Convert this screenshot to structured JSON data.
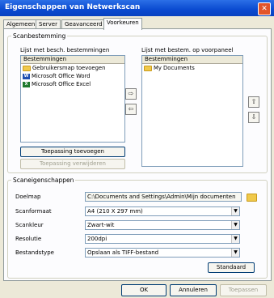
{
  "window": {
    "title": "Eigenschappen van Netwerkscan",
    "close_symbol": "✕"
  },
  "tabs": [
    "Algemeen",
    "Server",
    "Geavanceerd",
    "Voorkeuren"
  ],
  "scan_destination": {
    "legend": "Scanbestemming",
    "left_list": {
      "label": "Lijst met besch. bestemmingen",
      "header": "Bestemmingen",
      "items": [
        {
          "label": "Gebruikersmap toevoegen",
          "icon": "folder-icon"
        },
        {
          "label": "Microsoft Office Word",
          "icon": "word-icon",
          "glyph": "W"
        },
        {
          "label": "Microsoft Office Excel",
          "icon": "excel-icon",
          "glyph": "X"
        }
      ]
    },
    "right_list": {
      "label": "Lijst met bestem. op voorpaneel",
      "header": "Bestemmingen",
      "items": [
        {
          "label": "My Documents",
          "icon": "folder-icon"
        }
      ]
    },
    "add_app_button": "Toepassing toevoegen",
    "remove_app_button": "Toepassing verwijderen",
    "move_right_glyph": "⇨",
    "move_left_glyph": "⇦",
    "move_up_glyph": "⇧",
    "move_down_glyph": "⇩"
  },
  "scan_properties": {
    "legend": "Scaneigenschappen",
    "destination_folder_label": "Doelmap",
    "destination_folder_value": "C:\\Documents and Settings\\Admin\\Mijn documenten",
    "scan_format_label": "Scanformaat",
    "scan_format_value": "A4 (210 X 297 mm)",
    "scan_color_label": "Scankleur",
    "scan_color_value": "Zwart-wit",
    "resolution_label": "Resolutie",
    "resolution_value": "200dpi",
    "file_type_label": "Bestandstype",
    "file_type_value": "Opslaan als TIFF-bestand",
    "default_button": "Standaard",
    "dropdown_glyph": "▼"
  },
  "dialog_buttons": {
    "ok": "OK",
    "cancel": "Annuleren",
    "apply": "Toepassen"
  }
}
